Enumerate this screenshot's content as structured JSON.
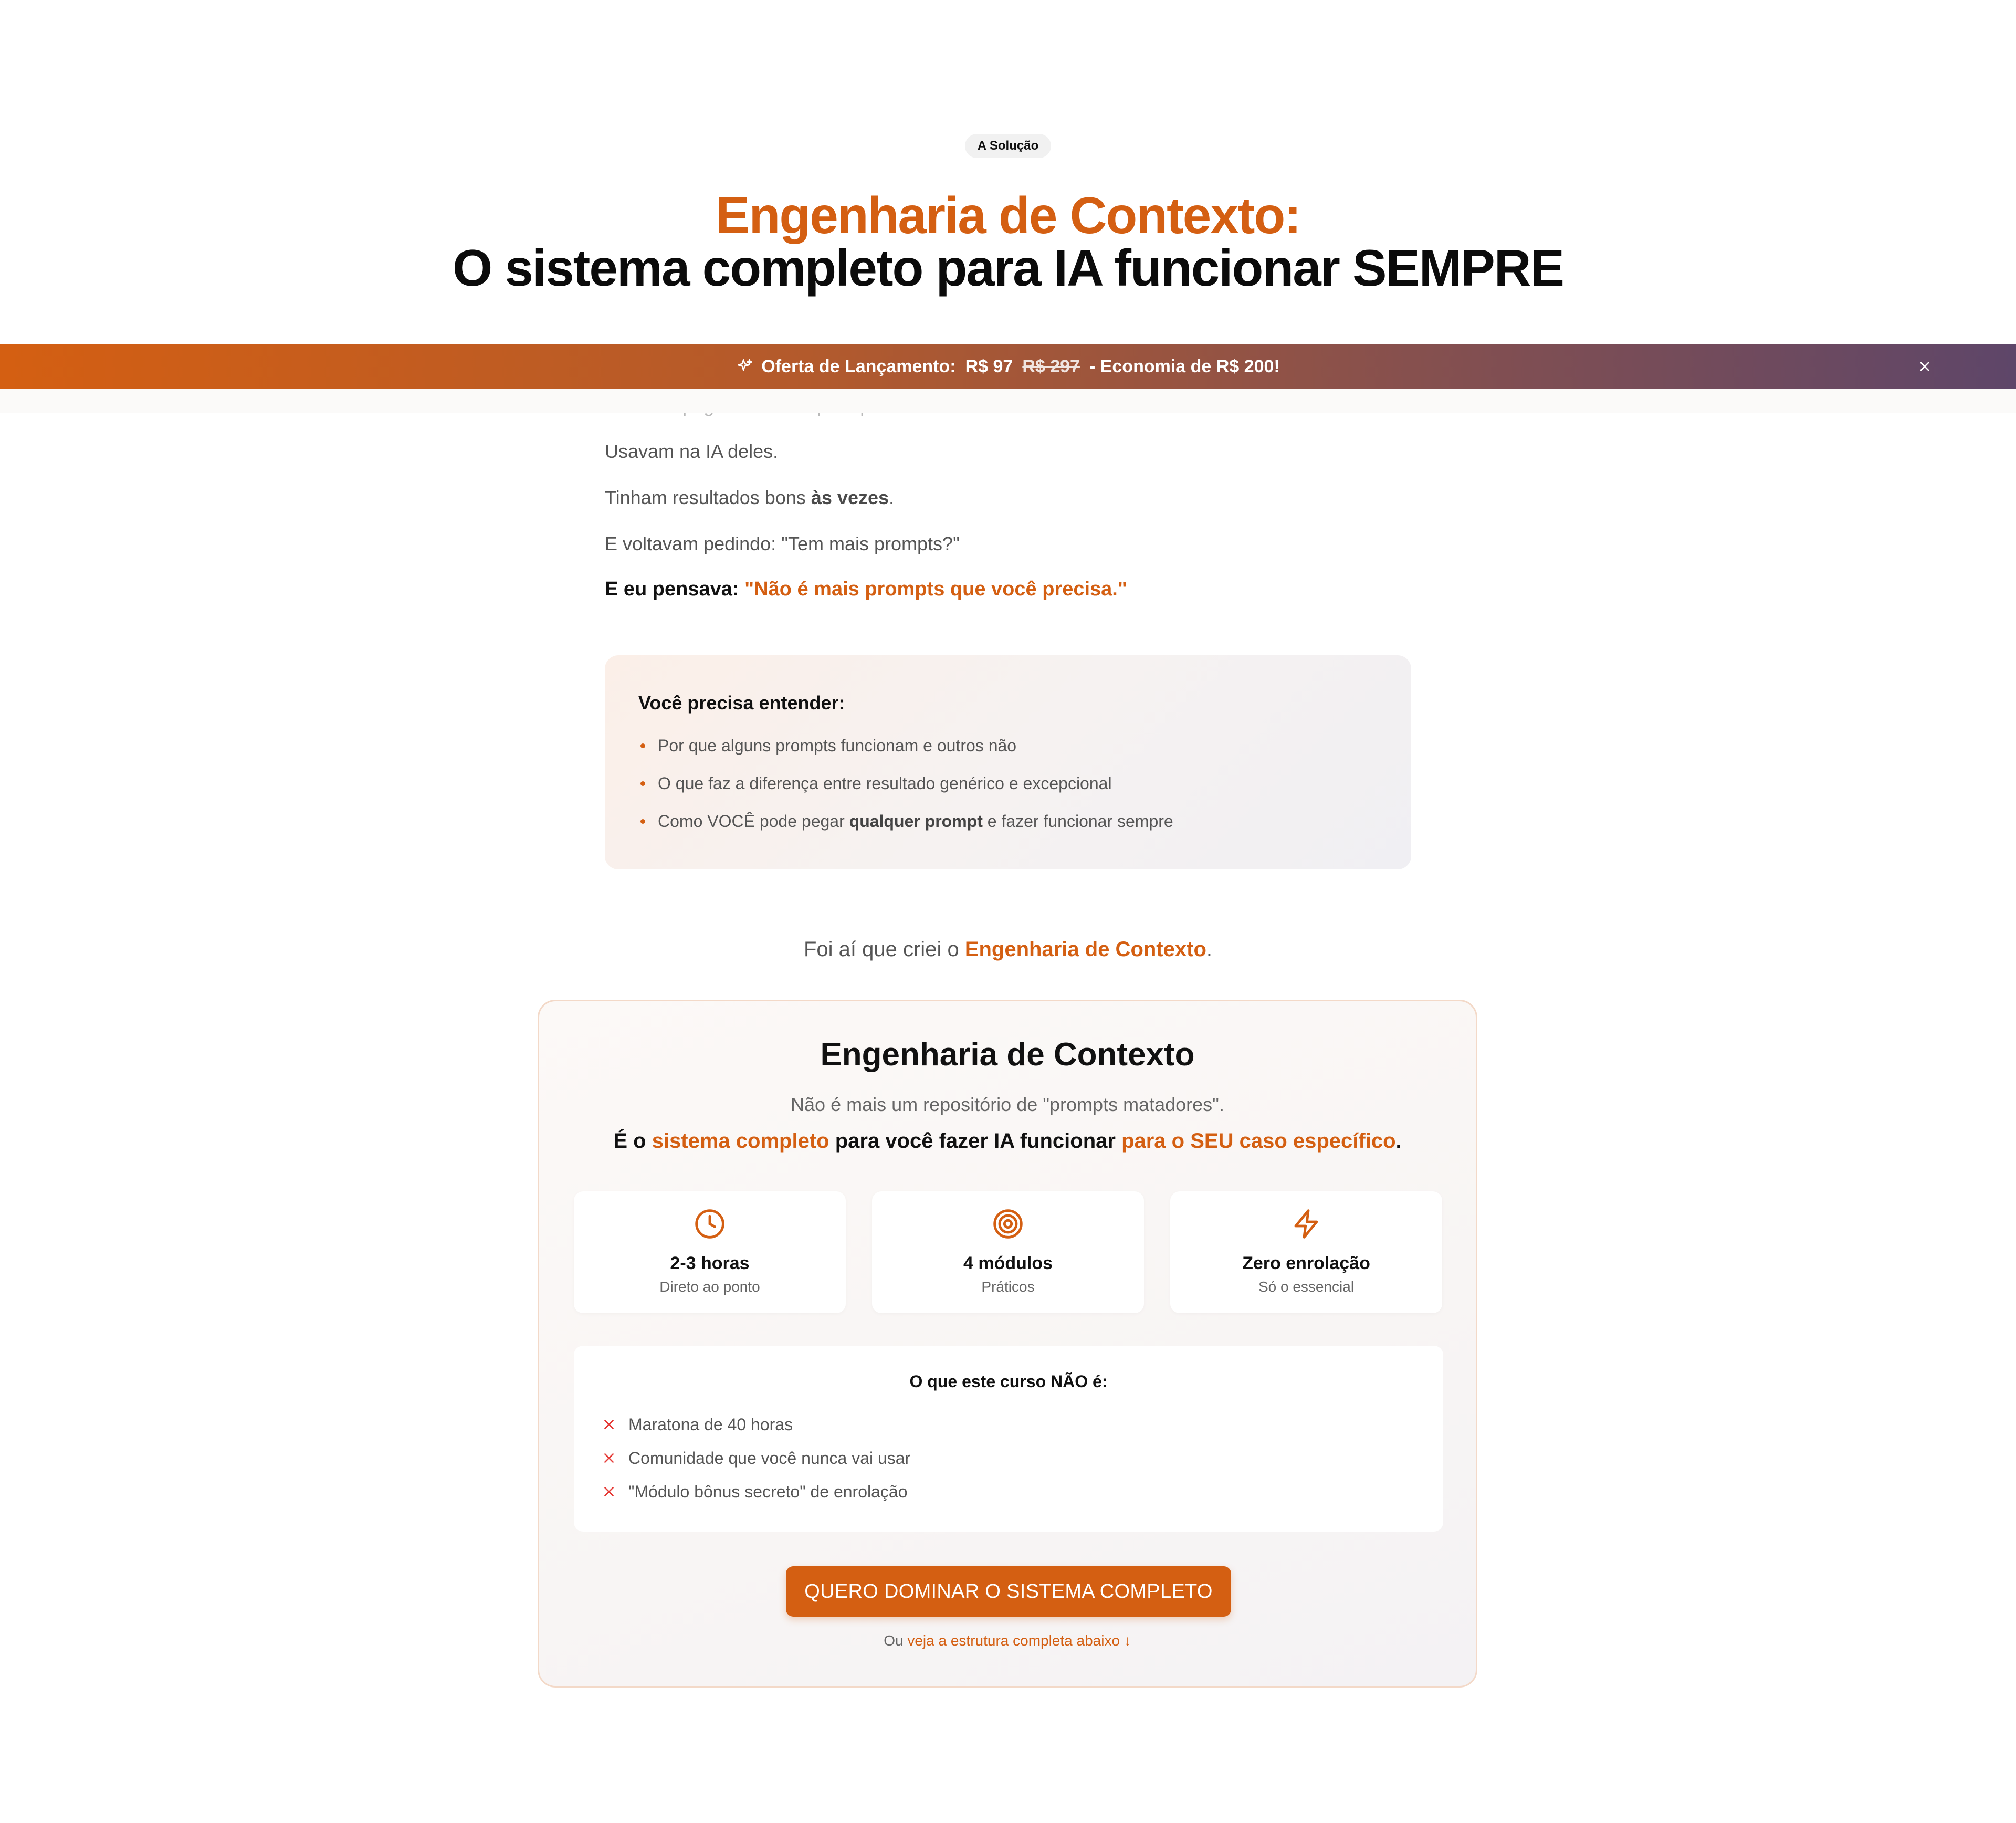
{
  "colors": {
    "accent": "#d45f12",
    "text": "#0b0b0b",
    "muted": "#555555",
    "danger": "#e53935"
  },
  "section": {
    "badge": "A Solução",
    "title_orange": "Engenharia de Contexto:",
    "title_black": "O sistema completo para IA funcionar SEMPRE"
  },
  "announcement": {
    "icon": "sparkles-icon",
    "label": "Oferta de Lançamento:",
    "price": "R$ 97",
    "old_price": "R$ 297",
    "savings": "- Economia de R$ 200!",
    "close_icon": "close-icon"
  },
  "story": {
    "faded_line": "Pessoas pegavam meus prompts.",
    "line1": "Usavam na IA deles.",
    "line2_pre": "Tinham resultados bons ",
    "line2_bold": "às vezes",
    "line2_post": ".",
    "line3": "E voltavam pedindo: \"Tem mais prompts?\"",
    "think_pre": "E eu pensava: ",
    "think_quote": "\"Não é mais prompts que você precisa.\""
  },
  "understand": {
    "title": "Você precisa entender:",
    "item1": "Por que alguns prompts funcionam e outros não",
    "item2": "O que faz a diferença entre resultado genérico e excepcional",
    "item3_pre": "Como VOCÊ pode pegar ",
    "item3_bold": "qualquer prompt",
    "item3_post": " e fazer funcionar sempre"
  },
  "transition": {
    "pre": "Foi aí que criei o ",
    "bold": "Engenharia de Contexto",
    "post": "."
  },
  "product": {
    "title": "Engenharia de Contexto",
    "subtitle": "Não é mais um repositório de \"prompts matadores\".",
    "line_pre": "É o ",
    "line_o1": "sistema completo",
    "line_mid": " para você fazer IA funcionar ",
    "line_o2": "para o SEU caso específico",
    "line_post": ".",
    "features": [
      {
        "icon": "clock-icon",
        "title": "2-3 horas",
        "subtitle": "Direto ao ponto"
      },
      {
        "icon": "target-icon",
        "title": "4 módulos",
        "subtitle": "Práticos"
      },
      {
        "icon": "lightning-icon",
        "title": "Zero enrolação",
        "subtitle": "Só o essencial"
      }
    ],
    "not_title": "O que este curso NÃO é:",
    "not_items": [
      "Maratona de 40 horas",
      "Comunidade que você nunca vai usar",
      "\"Módulo bônus secreto\" de enrolação"
    ],
    "cta": "QUERO DOMINAR O SISTEMA COMPLETO",
    "alt_pre": "Ou ",
    "alt_link": "veja a estrutura completa abaixo ↓"
  }
}
